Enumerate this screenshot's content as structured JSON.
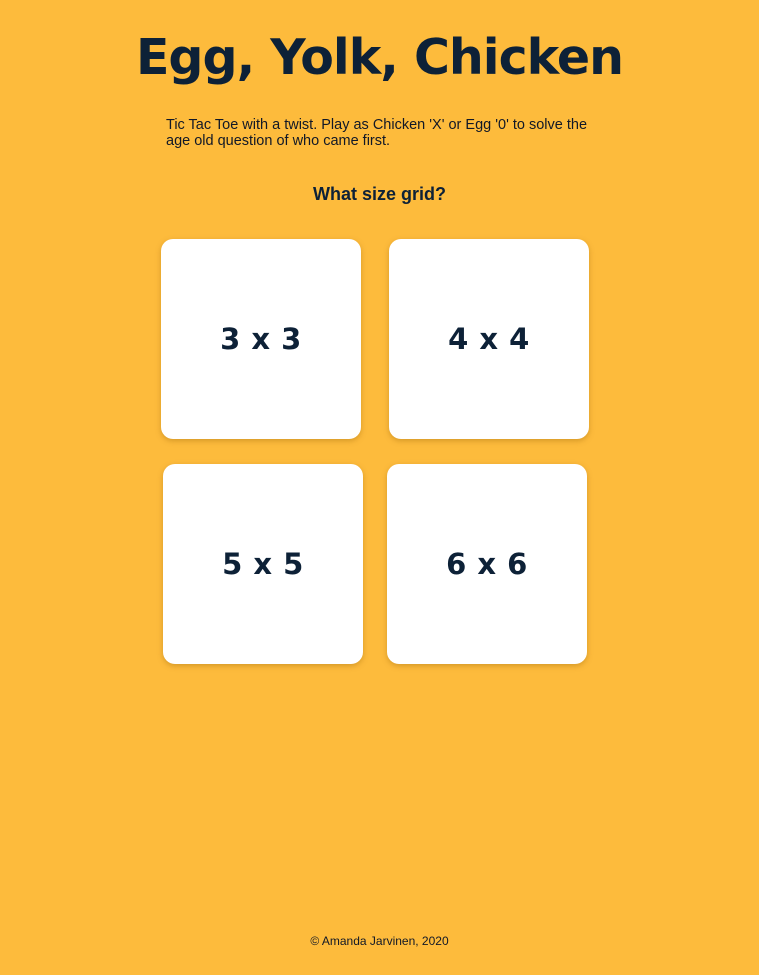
{
  "header": {
    "title": "Egg, Yolk, Chicken",
    "intro": "Tic Tac Toe with a twist. Play as Chicken 'X' or Egg '0' to solve the age old question of who came first.",
    "question": "What size grid?"
  },
  "grid_options": [
    {
      "label": "3 x 3"
    },
    {
      "label": "4 x 4"
    },
    {
      "label": "5 x 5"
    },
    {
      "label": "6 x 6"
    }
  ],
  "footer": {
    "copyright": "© Amanda Jarvinen, 2020"
  },
  "colors": {
    "background": "#FDBB3C",
    "text_primary": "#0D2137",
    "card": "#FFFFFF"
  }
}
